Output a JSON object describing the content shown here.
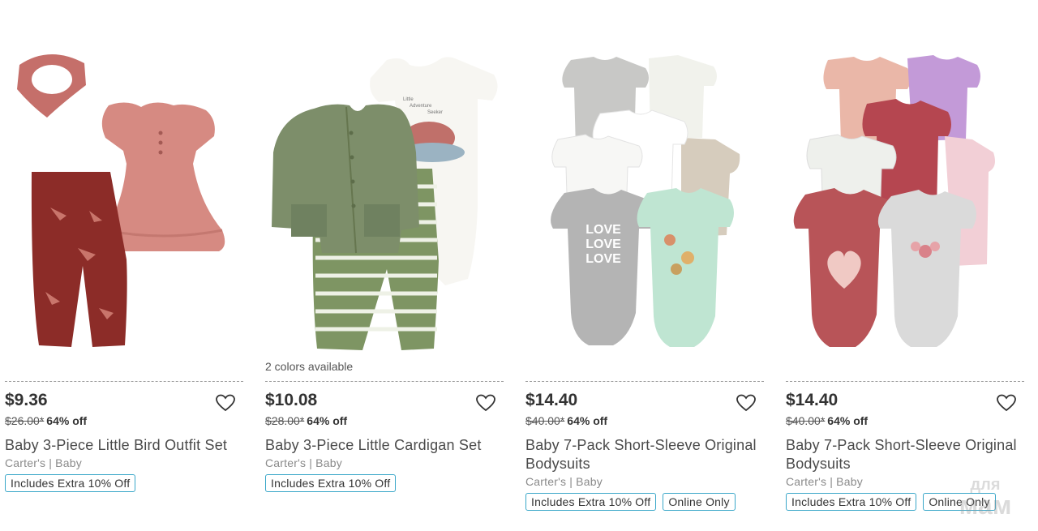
{
  "products": [
    {
      "colors_note": "",
      "price": "$9.36",
      "original_price": "$26.00*",
      "discount": "64% off",
      "title": "Baby 3-Piece Little Bird Outfit Set",
      "brand": "Carter's | Baby",
      "badges": [
        "Includes Extra 10% Off"
      ]
    },
    {
      "colors_note": "2 colors available",
      "price": "$10.08",
      "original_price": "$28.00*",
      "discount": "64% off",
      "title": "Baby 3-Piece Little Cardigan Set",
      "brand": "Carter's | Baby",
      "badges": [
        "Includes Extra 10% Off"
      ]
    },
    {
      "colors_note": "",
      "price": "$14.40",
      "original_price": "$40.00*",
      "discount": "64% off",
      "title": "Baby 7-Pack Short-Sleeve Original Bodysuits",
      "brand": "Carter's | Baby",
      "badges": [
        "Includes Extra 10% Off",
        "Online Only"
      ]
    },
    {
      "colors_note": "",
      "price": "$14.40",
      "original_price": "$40.00*",
      "discount": "64% off",
      "title": "Baby 7-Pack Short-Sleeve Original Bodysuits",
      "brand": "Carter's | Baby",
      "badges": [
        "Includes Extra 10% Off",
        "Online Only"
      ]
    }
  ],
  "icons": {
    "favorite": "heart-outline-icon"
  },
  "colors": {
    "badge_border": "#3aa7c9",
    "text": "#333333",
    "muted": "#8a8a8a"
  },
  "watermark": {
    "line1": "для",
    "line2": "мам"
  },
  "product_images": [
    {
      "mug_words": [
        "Little",
        "Adventure",
        "Seeker"
      ]
    },
    {
      "bodysuit_text": [
        "LOVE",
        "LOVE",
        "LOVE"
      ]
    }
  ]
}
